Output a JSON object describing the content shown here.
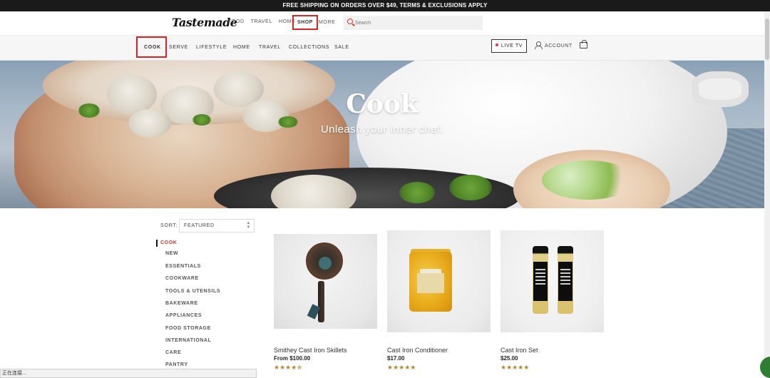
{
  "promo_banner": "FREE SHIPPING ON ORDERS OVER $49, TERMS & EXCLUSIONS APPLY",
  "top_nav": {
    "logo": "Tastemade",
    "links": [
      "FOOD",
      "TRAVEL",
      "HOME"
    ],
    "shop": "SHOP",
    "more": "MORE",
    "search_placeholder": "Search"
  },
  "category_nav": {
    "items": [
      "COOK",
      "SERVE",
      "LIFESTYLE",
      "HOME",
      "TRAVEL",
      "COLLECTIONS",
      "SALE"
    ],
    "live_tv": "LIVE TV",
    "account": "ACCOUNT"
  },
  "hero": {
    "title": "Cook",
    "subtitle": "Unleash your inner chef."
  },
  "sort": {
    "label": "SORT:",
    "selected": "FEATURED"
  },
  "sidebar": {
    "active": "COOK",
    "items": [
      "NEW",
      "ESSENTIALS",
      "COOKWARE",
      "TOOLS & UTENSILS",
      "BAKEWARE",
      "APPLIANCES",
      "FOOD STORAGE",
      "INTERNATIONAL",
      "CARE",
      "PANTRY"
    ]
  },
  "products": [
    {
      "name": "Smithey Cast Iron Skillets",
      "price": "From $100.00",
      "stars": "★★★★✯",
      "rating": 4.5
    },
    {
      "name": "Cast Iron Conditioner",
      "price": "$17.00",
      "stars": "★★★★★",
      "rating": 5
    },
    {
      "name": "Cast Iron Set",
      "price": "$25.00",
      "stars": "★★★★★",
      "rating": 5
    }
  ],
  "status_bar": "正在连接...",
  "colors": {
    "accent_red": "#d22222",
    "promo_bg": "#1a1a1a",
    "star_gold": "#b48a35"
  }
}
